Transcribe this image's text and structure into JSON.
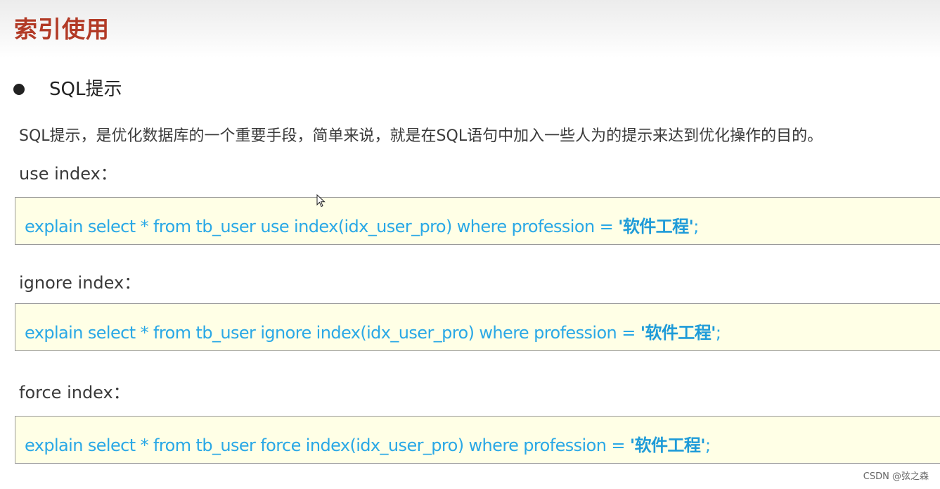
{
  "page": {
    "title": "索引使用",
    "section_heading": "SQL提示",
    "description": "SQL提示，是优化数据库的一个重要手段，简单来说，就是在SQL语句中加入一些人为的提示来达到优化操作的目的。"
  },
  "hints": [
    {
      "label": "use index：",
      "code_prefix": "explain select * from tb_user use index(idx_user_pro) where profession = ",
      "code_literal": "'软件工程'",
      "code_suffix": ";"
    },
    {
      "label": "ignore index：",
      "code_prefix": "explain select * from tb_user ignore index(idx_user_pro) where profession = ",
      "code_literal": "'软件工程'",
      "code_suffix": ";"
    },
    {
      "label": "force index：",
      "code_prefix": "explain select * from tb_user force index(idx_user_pro) where profession = ",
      "code_literal": "'软件工程'",
      "code_suffix": ";"
    }
  ],
  "watermark": "CSDN @弦之森",
  "colors": {
    "title": "#b23a26",
    "code_text": "#2aa8e6",
    "code_background": "#ffffe6"
  },
  "icons": {
    "bullet": "bullet-icon",
    "cursor": "mouse-pointer-icon"
  }
}
